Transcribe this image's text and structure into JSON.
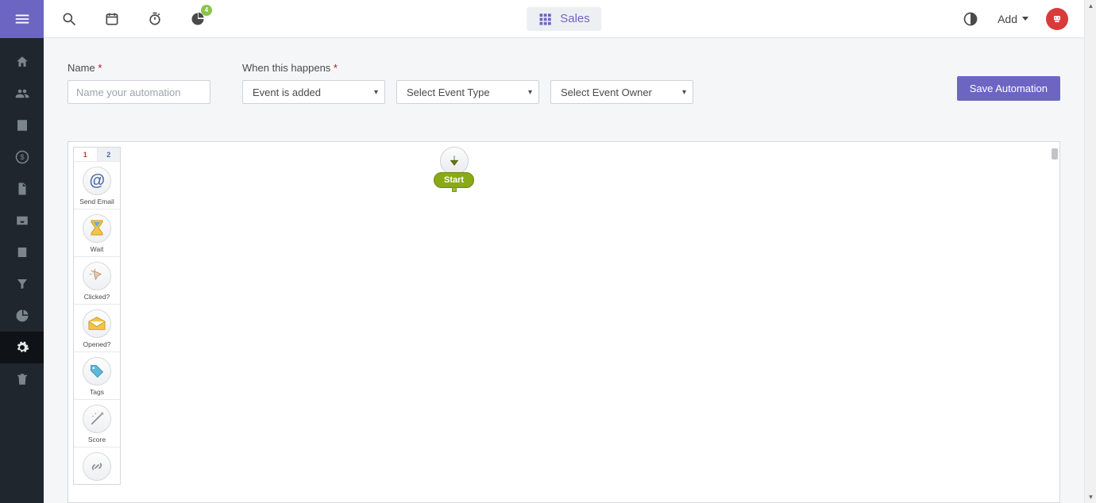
{
  "sidebar": {
    "items": [
      {
        "name": "home"
      },
      {
        "name": "contacts"
      },
      {
        "name": "companies"
      },
      {
        "name": "deals"
      },
      {
        "name": "documents"
      },
      {
        "name": "tasks"
      },
      {
        "name": "calendar"
      },
      {
        "name": "pipeline"
      },
      {
        "name": "analytics"
      },
      {
        "name": "automations",
        "active": true
      },
      {
        "name": "trash"
      }
    ]
  },
  "topbar": {
    "badge_count": "4",
    "section_label": "Sales",
    "add_label": "Add"
  },
  "form": {
    "name_label": "Name",
    "name_placeholder": "Name your automation",
    "trigger_label": "When this happens",
    "trigger_event_value": "Event is added",
    "event_type_placeholder": "Select Event Type",
    "event_owner_placeholder": "Select Event Owner",
    "save_label": "Save Automation"
  },
  "palette": {
    "tabs": [
      "1",
      "2"
    ],
    "items": [
      {
        "key": "send-email",
        "label": "Send Email"
      },
      {
        "key": "wait",
        "label": "Wait"
      },
      {
        "key": "clicked",
        "label": "Clicked?"
      },
      {
        "key": "opened",
        "label": "Opened?"
      },
      {
        "key": "tags",
        "label": "Tags"
      },
      {
        "key": "score",
        "label": "Score"
      },
      {
        "key": "link",
        "label": ""
      }
    ]
  },
  "start_node": {
    "label": "Start"
  }
}
